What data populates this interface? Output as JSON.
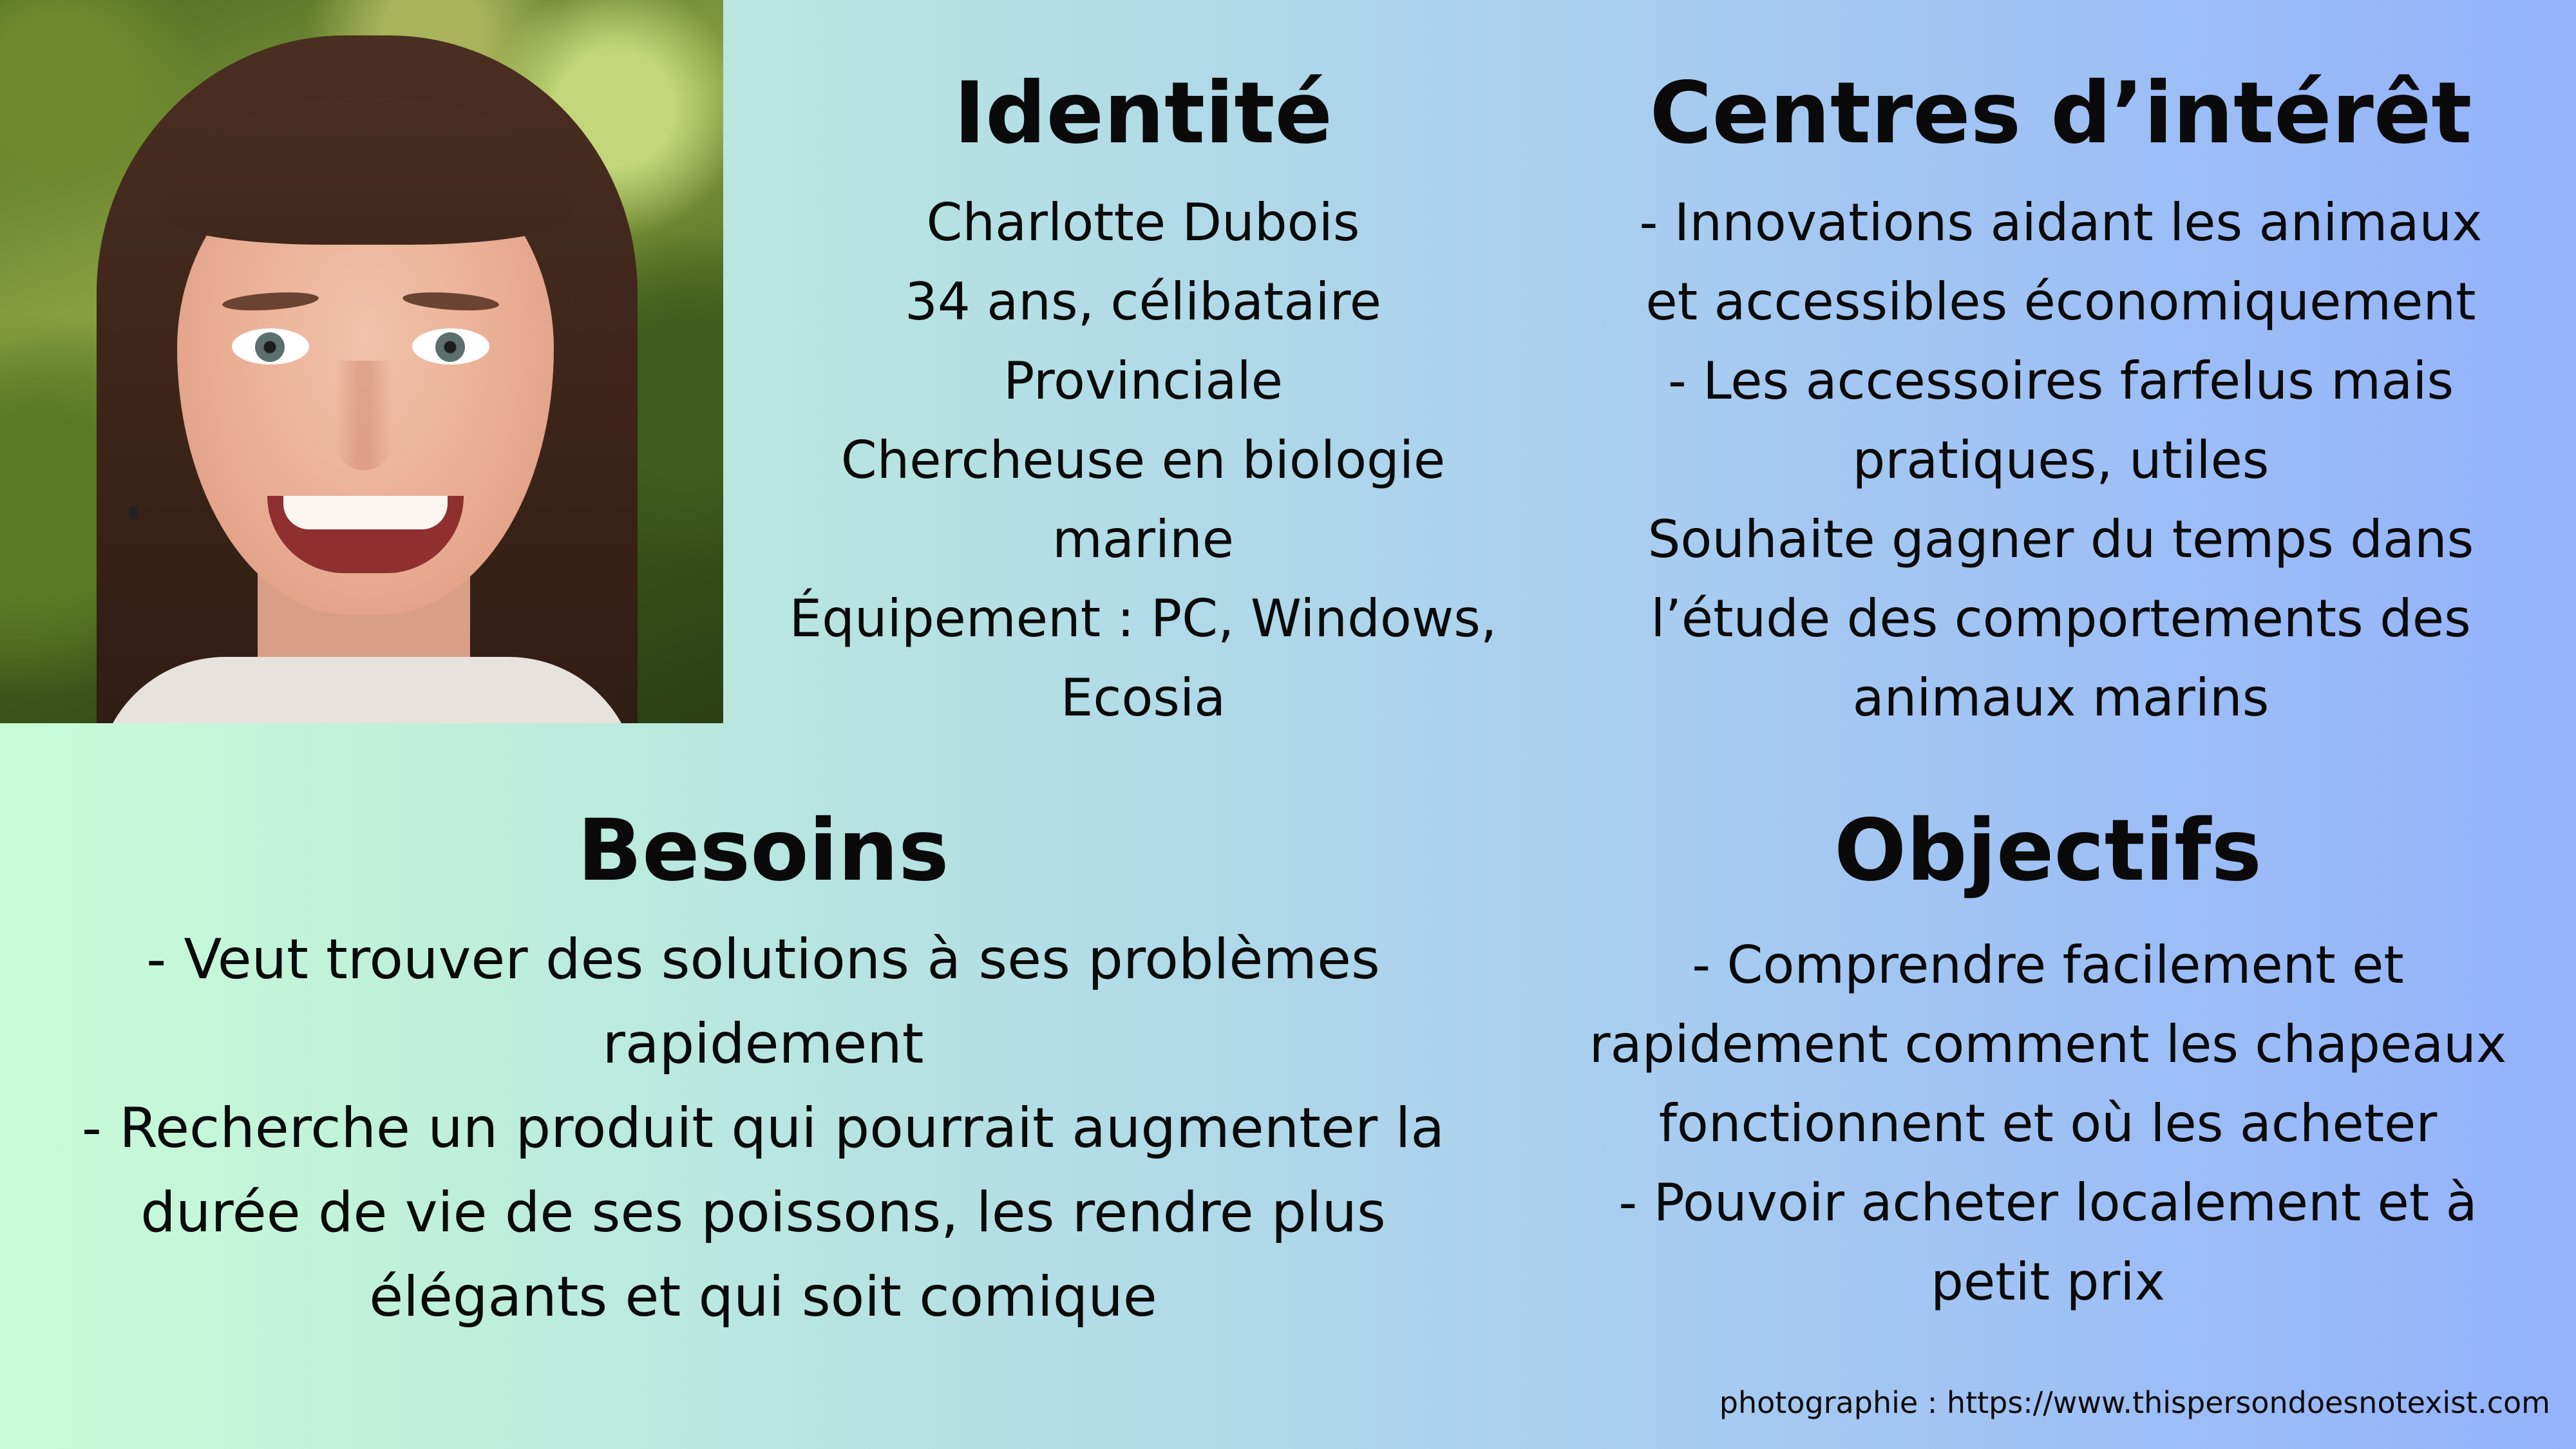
{
  "photo": {
    "subject": "portrait-photo"
  },
  "identite": {
    "title": "Identité",
    "lines": [
      "Charlotte Dubois",
      "34 ans, célibataire",
      "Provinciale",
      "Chercheuse en biologie",
      "marine",
      "Équipement : PC, Windows,",
      "Ecosia"
    ]
  },
  "interets": {
    "title": "Centres d’intérêt",
    "lines": [
      "- Innovations aidant les animaux",
      "et accessibles économiquement",
      "- Les accessoires farfelus mais",
      "pratiques, utiles",
      "Souhaite gagner du temps dans",
      "l’étude des comportements des",
      "animaux marins"
    ]
  },
  "besoins": {
    "title": "Besoins",
    "lines": [
      "- Veut trouver des solutions à ses problèmes",
      "rapidement",
      "- Recherche un produit qui pourrait augmenter la",
      "durée de vie de ses poissons, les rendre plus",
      "élégants et qui soit comique"
    ]
  },
  "objectifs": {
    "title": "Objectifs",
    "lines": [
      "- Comprendre facilement et",
      "rapidement comment les chapeaux",
      "fonctionnent et où les acheter",
      "- Pouvoir acheter localement et à",
      "petit prix"
    ]
  },
  "credit": {
    "text": "photographie : https://www.thispersondoesnotexist.com"
  }
}
